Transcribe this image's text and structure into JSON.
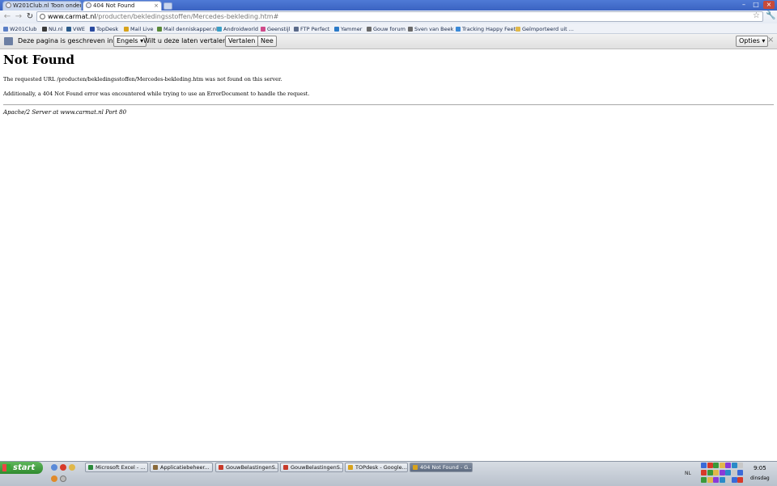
{
  "browser": {
    "tabs": [
      {
        "label": "W201Club.nl Toon onder"
      },
      {
        "label": "404 Not Found"
      }
    ],
    "url_host": "www.carmat.nl",
    "url_path": "/producten/bekledingsstoffen/Mercedes-bekleding.htm#"
  },
  "bookmarks": [
    {
      "label": "W201Club",
      "color": "#5b7fc6"
    },
    {
      "label": "NU.nl",
      "color": "#3a3a3a"
    },
    {
      "label": "VWE",
      "color": "#2a5a8a"
    },
    {
      "label": "TopDesk",
      "color": "#2a4aa0"
    },
    {
      "label": "Mail Live",
      "color": "#d8a31c"
    },
    {
      "label": "Mail denniskapper.nl",
      "color": "#5a8a3a"
    },
    {
      "label": "Androidworld",
      "color": "#3aa0c8"
    },
    {
      "label": "Geenstijl",
      "color": "#d04a8a"
    },
    {
      "label": "FTP Perfect",
      "color": "#5a6a8a"
    },
    {
      "label": "Yammer",
      "color": "#2a7ac8"
    },
    {
      "label": "Gouw forum",
      "color": "#6a6a6a"
    },
    {
      "label": "Sven van Beek",
      "color": "#6a6a6a"
    },
    {
      "label": "Tracking Happy Feet",
      "color": "#3a8ad8"
    },
    {
      "label": "Geïmporteerd uit ...",
      "color": "#e0b84a"
    }
  ],
  "translate_bar": {
    "text1": "Deze pagina is geschreven in het",
    "language": "Engels",
    "text2": "Wilt u deze laten vertalen?",
    "translate_button": "Vertalen",
    "no_button": "Nee",
    "options_button": "Opties",
    "close": "×"
  },
  "page": {
    "title": "Not Found",
    "line1": "The requested URL /producten/bekledingsstoffen/Mercedes-bekleding.htm was not found on this server.",
    "line2": "Additionally, a 404 Not Found error was encountered while trying to use an ErrorDocument to handle the request.",
    "address": "Apache/2 Server at www.carmat.nl Port 80"
  },
  "taskbar": {
    "start_label": "start",
    "tasks": [
      {
        "label": "Microsoft Excel - ...",
        "color": "#2a8a3a"
      },
      {
        "label": "Applicatiebeheer...",
        "color": "#8a6a3a"
      },
      {
        "label": "GouwBelastingenS...",
        "color": "#c83a2a"
      },
      {
        "label": "GouwBelastingenS...",
        "color": "#c83a2a"
      },
      {
        "label": "TOPdesk - Google...",
        "color": "#d8a31c"
      },
      {
        "label": "404 Not Found - G...",
        "color": "#d8a31c",
        "active": true
      }
    ],
    "language": "NL",
    "time": "9:05",
    "day": "dinsdag"
  }
}
